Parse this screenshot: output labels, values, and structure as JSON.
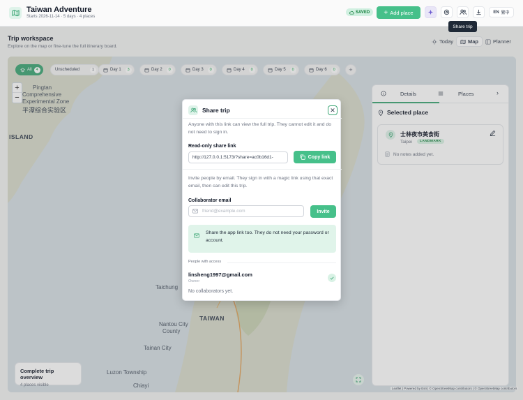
{
  "header": {
    "title": "Taiwan Adventure",
    "subtitle": "Starts 2026-11-14 · 5 days · 4 places",
    "saved_label": "SAVED",
    "add_place_label": "Add place",
    "language": {
      "current": "EN",
      "alternate": "繁中"
    },
    "tooltip": "Share trip",
    "icons": [
      "logo-map-icon",
      "sparkle-icon",
      "settings-icon",
      "share-people-icon",
      "download-icon"
    ]
  },
  "workspace": {
    "title": "Trip workspace",
    "subtitle": "Explore on the map or fine-tune the full itinerary board.",
    "views": [
      {
        "label": "Today",
        "active": false
      },
      {
        "label": "Map",
        "active": true
      },
      {
        "label": "Planner",
        "active": false
      }
    ]
  },
  "filters": [
    {
      "label": "All",
      "count": "4"
    },
    {
      "label": "Unscheduled",
      "count": "1"
    },
    {
      "label": "Day 1",
      "count": "3"
    },
    {
      "label": "Day 2",
      "count": "0"
    },
    {
      "label": "Day 3",
      "count": "0"
    },
    {
      "label": "Day 4",
      "count": "0"
    },
    {
      "label": "Day 5",
      "count": "0"
    },
    {
      "label": "Day 6",
      "count": "0"
    }
  ],
  "map": {
    "zoom_in": "+",
    "zoom_out": "−",
    "labels": {
      "pingtan": "Pingtan",
      "comprehensive": "Comprehensive",
      "experimental": "Experimental Zone",
      "cn_zone": "平潭综合实验区",
      "island": "ISLAND",
      "taichung": "Taichung",
      "taiwan": "TAIWAN",
      "nantou": "Nantou City",
      "county": "County",
      "tainan": "Tainan City",
      "luzon": "Luzon Township",
      "chiayi": "Chiayi"
    },
    "overview_title": "Complete trip overview",
    "overview_sub": "4 places visible",
    "attribution": "Leaflet | Powered by Esri | © OpenStreetMap contributors | © OpenStreetMap contributors"
  },
  "panel": {
    "tabs": [
      {
        "label": "Details"
      },
      {
        "label": "Places"
      }
    ],
    "selected_title": "Selected place",
    "place": {
      "name": "士林夜市美食街",
      "city": "Taipei",
      "badge": "LANDMARK",
      "notes": "No notes added yet."
    }
  },
  "modal": {
    "title": "Share trip",
    "desc": "Anyone with this link can view the full trip. They cannot edit it and do not need to sign in.",
    "link_label": "Read-only share link",
    "link_value": "http://127.0.0.1:5173/?share=ac0b16d1-",
    "copy_label": "Copy link",
    "invite_desc": "Invite people by email. They sign in with a magic link using that exact email, then can edit this trip.",
    "collab_label": "Collaborator email",
    "email_placeholder": "friend@example.com",
    "invite_label": "Invite",
    "info_text": "Share the app link too. They do not need your password or account.",
    "access_label": "People with access",
    "owner_email": "linsheng1997@gmail.com",
    "owner_role": "Owner",
    "no_collab": "No collaborators yet."
  },
  "colors": {
    "accent": "#46c08a",
    "accent_dark": "#3fa777",
    "accent_light": "#dff3ea",
    "sea": "#d6dfe5",
    "land": "#d9dccc"
  }
}
